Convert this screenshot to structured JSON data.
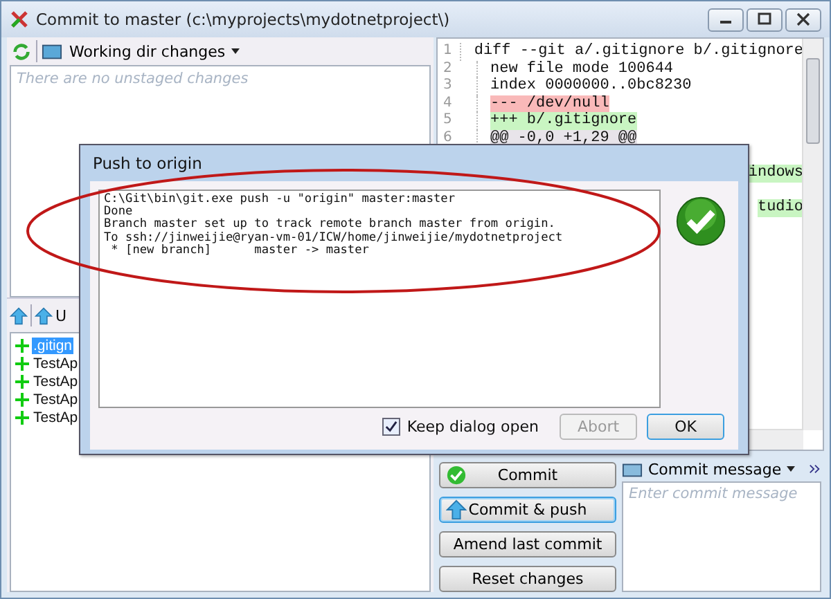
{
  "window": {
    "title": "Commit to master (c:\\myprojects\\mydotnetproject\\)"
  },
  "unstaged": {
    "toolbar_label": "Working dir changes",
    "empty_text": "There are no unstaged changes"
  },
  "staged": {
    "toolbar_label": "U",
    "files": [
      {
        "name": ".gitign",
        "selected": true
      },
      {
        "name": "TestAp",
        "selected": false
      },
      {
        "name": "TestAp",
        "selected": false
      },
      {
        "name": "TestAp",
        "selected": false
      },
      {
        "name": "TestAp",
        "selected": false
      }
    ]
  },
  "diff": {
    "lines": [
      {
        "number": "1",
        "text": "diff --git a/.gitignore b/.gitignore",
        "kind": "context"
      },
      {
        "number": "2",
        "text": "new file mode 100644",
        "kind": "context"
      },
      {
        "number": "3",
        "text": "index 0000000..0bc8230",
        "kind": "context"
      },
      {
        "number": "4",
        "text": "--- /dev/null",
        "kind": "removed"
      },
      {
        "number": "5",
        "text": "+++ b/.gitignore",
        "kind": "added"
      },
      {
        "number": "6",
        "text": "@@ -0,0 +1,29 @@",
        "kind": "hunk"
      },
      {
        "text": "indows",
        "kind": "added-fragment"
      },
      {
        "text": "tudio",
        "kind": "added-fragment"
      }
    ]
  },
  "actions": [
    {
      "label": "Commit",
      "kind": "commit",
      "focused": false
    },
    {
      "label": "Commit & push",
      "kind": "push",
      "focused": true
    },
    {
      "label": "Amend last commit",
      "kind": "plain",
      "focused": false
    },
    {
      "label": "Reset changes",
      "kind": "plain",
      "focused": false
    }
  ],
  "commit_message": {
    "label": "Commit message",
    "placeholder": "Enter commit message"
  },
  "dialog": {
    "title": "Push to origin",
    "output": [
      "C:\\Git\\bin\\git.exe push -u \"origin\" master:master",
      "Done",
      "Branch master set up to track remote branch master from origin.",
      "To ssh://jinweijie@ryan-vm-01/ICW/home/jinweijie/mydotnetproject",
      " * [new branch]      master -> master"
    ],
    "keep_open": {
      "label": "Keep dialog open",
      "checked": true
    },
    "buttons": [
      {
        "label": "Abort",
        "disabled": true,
        "default": false
      },
      {
        "label": "OK",
        "disabled": false,
        "default": true
      }
    ]
  }
}
